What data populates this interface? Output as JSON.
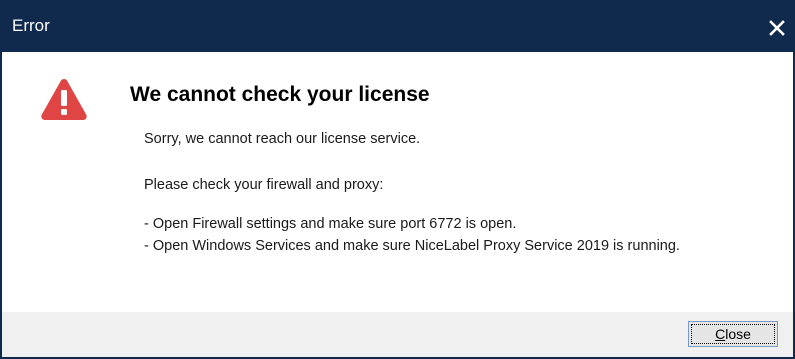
{
  "window": {
    "title": "Error",
    "titlebar_color": "#0f2a4d",
    "close_icon": "close-icon"
  },
  "dialog": {
    "icon": "warning-triangle-icon",
    "icon_color": "#e04545",
    "heading": "We cannot check your license",
    "lines": [
      "Sorry, we cannot reach our license service.",
      "Please check your firewall and proxy:",
      "- Open Firewall settings and make sure port 6772 is open.",
      "- Open Windows Services and make sure NiceLabel Proxy Service 2019 is running."
    ]
  },
  "footer": {
    "close_button_mnemonic": "C",
    "close_button_rest": "lose"
  }
}
